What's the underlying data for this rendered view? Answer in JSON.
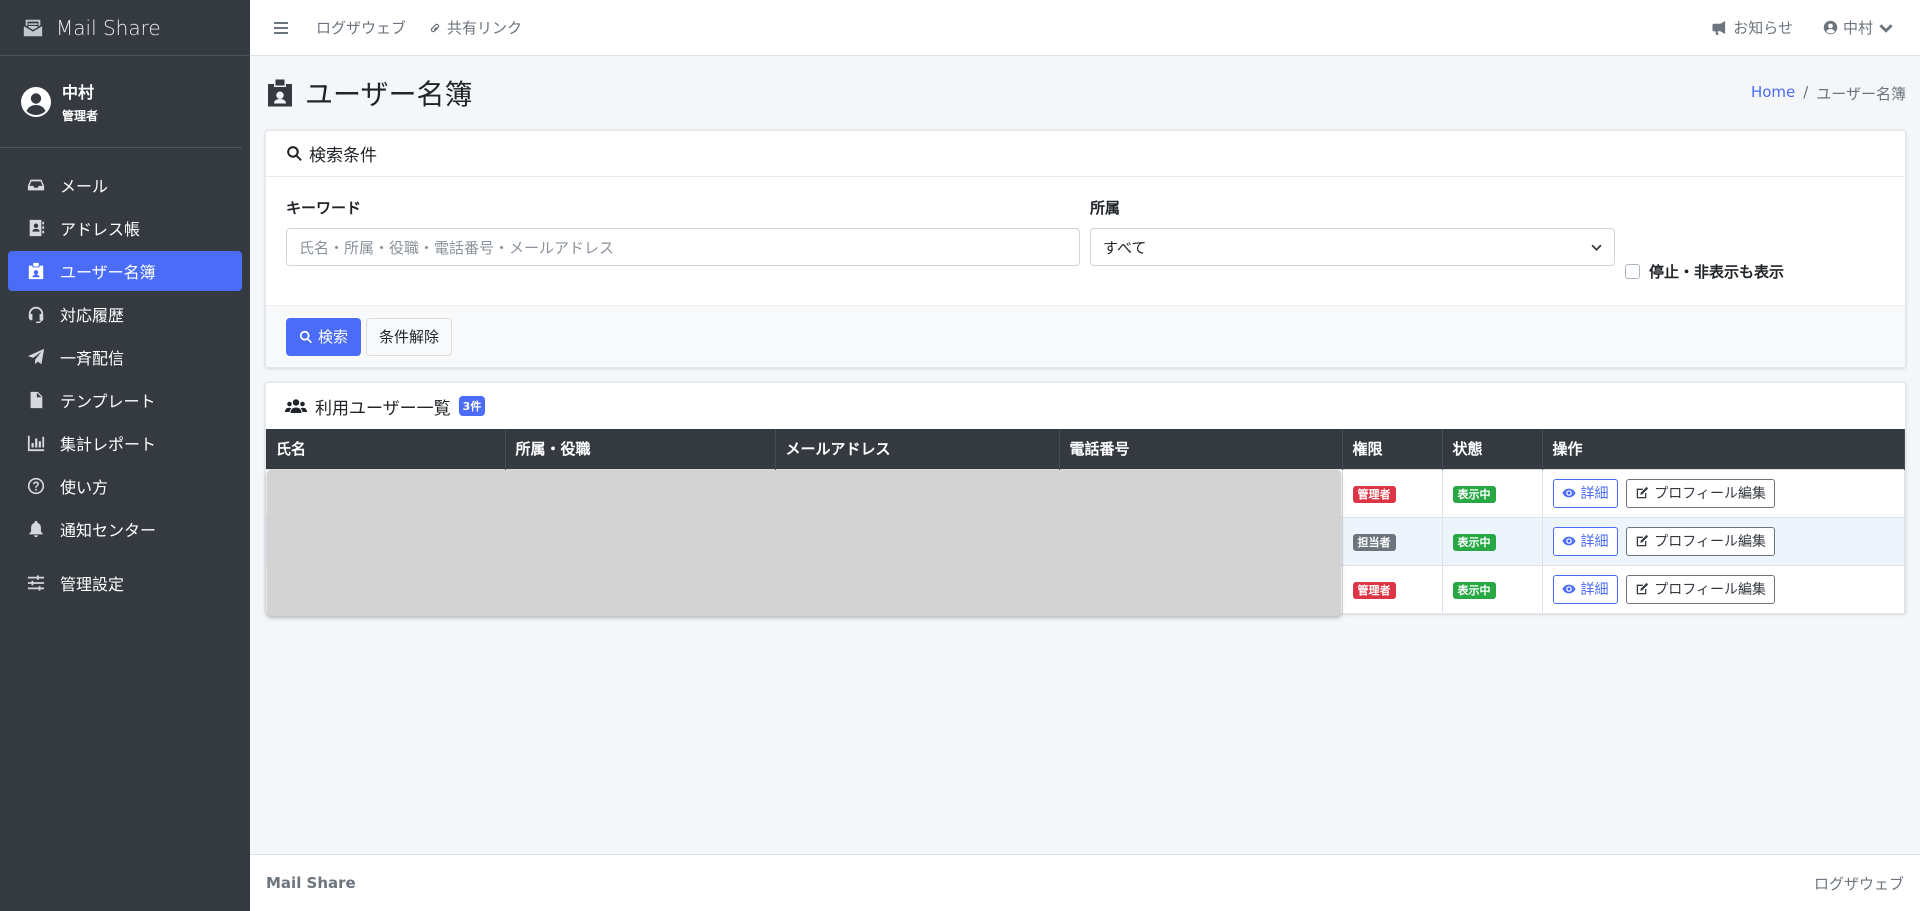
{
  "app": {
    "brand": "Mail Share"
  },
  "user": {
    "name": "中村",
    "role": "管理者"
  },
  "sidebar": {
    "items": [
      {
        "label": "メール",
        "icon": "inbox-icon"
      },
      {
        "label": "アドレス帳",
        "icon": "address-book-icon"
      },
      {
        "label": "ユーザー名簿",
        "icon": "id-badge-icon",
        "active": true
      },
      {
        "label": "対応履歴",
        "icon": "headset-icon"
      },
      {
        "label": "一斉配信",
        "icon": "paper-plane-icon"
      },
      {
        "label": "テンプレート",
        "icon": "file-icon"
      },
      {
        "label": "集計レポート",
        "icon": "chart-icon"
      },
      {
        "label": "使い方",
        "icon": "question-icon"
      },
      {
        "label": "通知センター",
        "icon": "bell-icon"
      },
      {
        "label": "管理設定",
        "icon": "sliders-icon"
      }
    ]
  },
  "topbar": {
    "links": [
      "ログザウェブ",
      "共有リンク"
    ],
    "notice": "お知らせ",
    "user": "中村"
  },
  "page": {
    "title": "ユーザー名簿",
    "breadcrumb": {
      "home": "Home",
      "current": "ユーザー名簿"
    }
  },
  "search": {
    "header": "検索条件",
    "keyword_label": "キーワード",
    "keyword_placeholder": "氏名・所属・役職・電話番号・メールアドレス",
    "dept_label": "所属",
    "dept_value": "すべて",
    "show_stopped_label": "停止・非表示も表示",
    "search_button": "検索",
    "clear_button": "条件解除"
  },
  "list": {
    "header": "利用ユーザー一覧",
    "count": "3件",
    "columns": [
      "氏名",
      "所属・役職",
      "メールアドレス",
      "電話番号",
      "権限",
      "状態",
      "操作"
    ],
    "rows": [
      {
        "role": "管理者",
        "role_color": "#dc3545",
        "status": "表示中"
      },
      {
        "role": "担当者",
        "role_color": "#6c757d",
        "status": "表示中"
      },
      {
        "role": "管理者",
        "role_color": "#dc3545",
        "status": "表示中"
      }
    ],
    "detail_button": "詳細",
    "edit_button": "プロフィール編集"
  },
  "footer": {
    "left": "Mail Share",
    "right": "ログザウェブ"
  },
  "colors": {
    "accent": "#4a6cf7",
    "sidebar": "#343a40",
    "danger": "#dc3545",
    "success": "#28a745"
  }
}
